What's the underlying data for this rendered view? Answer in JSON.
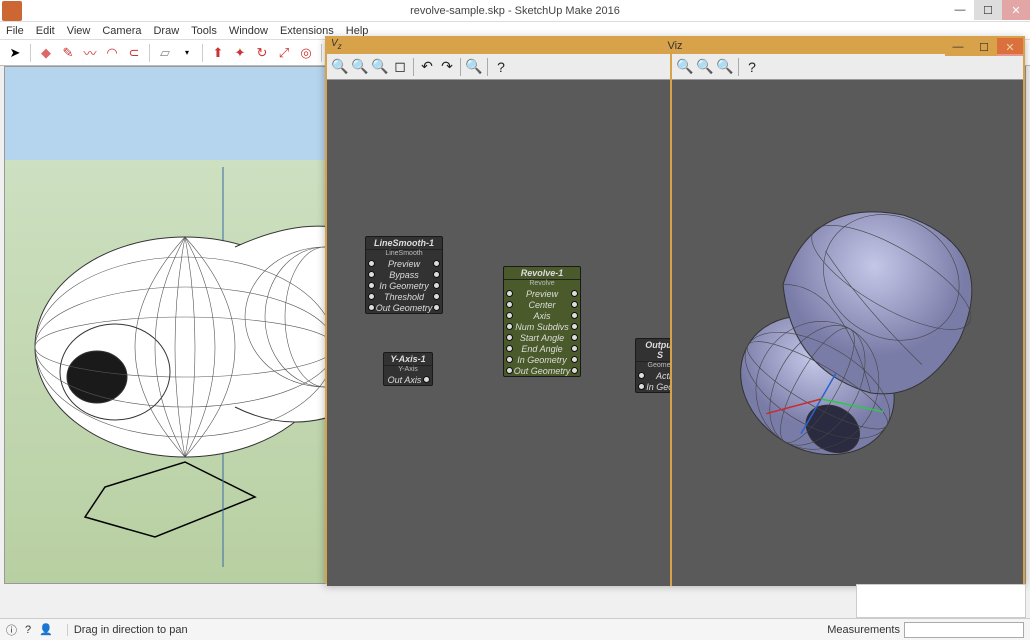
{
  "window": {
    "title": "revolve-sample.skp - SketchUp Make 2016"
  },
  "menu": [
    "File",
    "Edit",
    "View",
    "Camera",
    "Draw",
    "Tools",
    "Window",
    "Extensions",
    "Help"
  ],
  "viz": {
    "title": "Viz",
    "nodes": {
      "linesmooth": {
        "title": "LineSmooth-1",
        "sub": "LineSmooth",
        "rows": [
          "Preview",
          "Bypass",
          "In Geometry",
          "Threshold",
          "Out Geometry"
        ]
      },
      "yaxis": {
        "title": "Y-Axis-1",
        "sub": "Y-Axis",
        "rows": [
          "Out Axis"
        ]
      },
      "revolve": {
        "title": "Revolve-1",
        "sub": "Revolve",
        "rows": [
          "Preview",
          "Center",
          "Axis",
          "Num Subdivs",
          "Start Angle",
          "End Angle",
          "In Geometry",
          "Out Geometry"
        ]
      },
      "output": {
        "title": "Output S",
        "sub": "Geomet",
        "rows": [
          "Acti",
          "In Geom"
        ]
      }
    }
  },
  "status": {
    "hint": "Drag in direction to pan",
    "measLabel": "Measurements"
  }
}
